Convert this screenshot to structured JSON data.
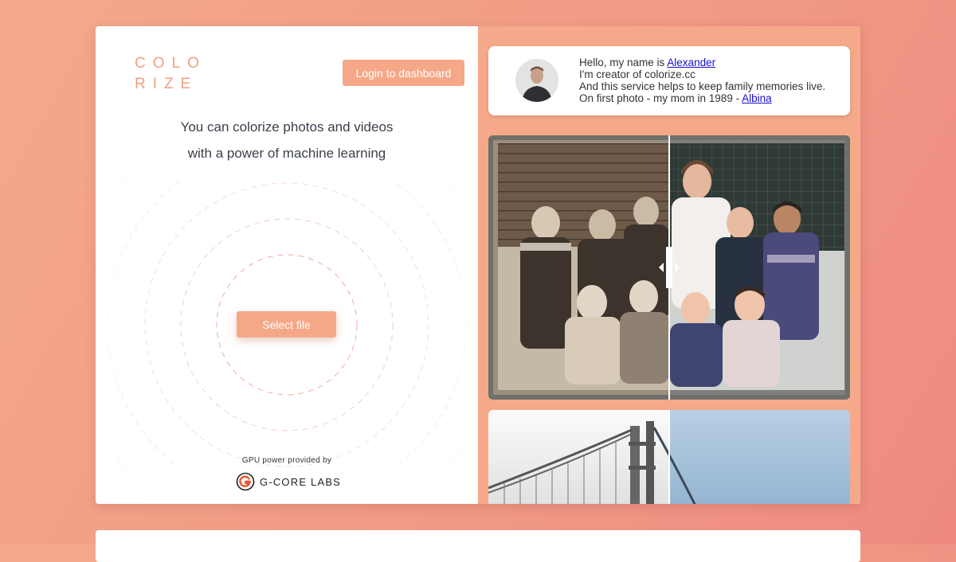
{
  "brand": {
    "logo_line1": "COLO",
    "logo_line2": "RIZE"
  },
  "header": {
    "login_label": "Login to dashboard"
  },
  "hero": {
    "tagline_line1": "You can colorize photos and videos",
    "tagline_line2": "with a power of machine learning",
    "select_label": "Select file"
  },
  "footer": {
    "gpu_label": "GPU power provided by",
    "sponsor_name": "G-CORE LABS"
  },
  "intro": {
    "line1_prefix": "Hello, my name is ",
    "name_link": "Alexander",
    "line2": "I'm creator of colorize.cc",
    "line3": "And this service helps to keep family memories live.",
    "line4_prefix": "On first photo - my mom in 1989 - ",
    "mom_link": "Albina"
  },
  "colors": {
    "accent": "#f5a888",
    "logo": "#f0a07e",
    "panel": "#f5a98a",
    "link": "#1a0dcc"
  },
  "icons": [
    "avatar-photo",
    "compare-handle-icon",
    "gcore-logo-icon"
  ]
}
